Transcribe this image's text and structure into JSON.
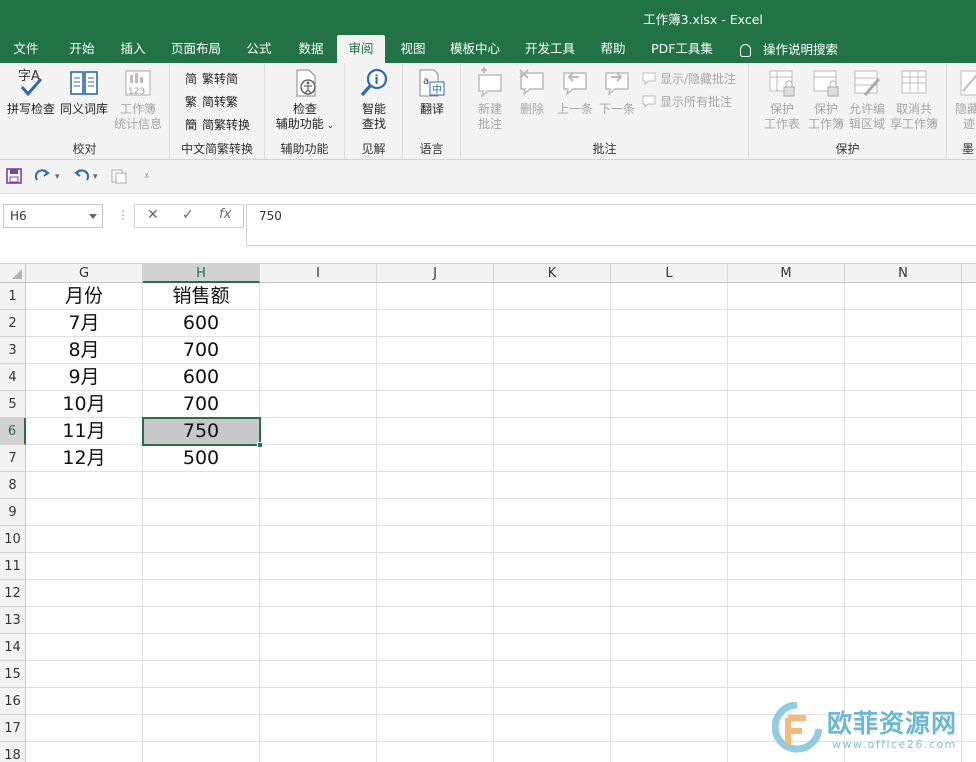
{
  "window": {
    "title": "工作簿3.xlsx  -  Excel"
  },
  "tabs": [
    {
      "label": "文件",
      "active": false
    },
    {
      "label": "开始",
      "active": false
    },
    {
      "label": "插入",
      "active": false
    },
    {
      "label": "页面布局",
      "active": false
    },
    {
      "label": "公式",
      "active": false
    },
    {
      "label": "数据",
      "active": false
    },
    {
      "label": "审阅",
      "active": true
    },
    {
      "label": "视图",
      "active": false
    },
    {
      "label": "模板中心",
      "active": false
    },
    {
      "label": "开发工具",
      "active": false
    },
    {
      "label": "帮助",
      "active": false
    },
    {
      "label": "PDF工具集",
      "active": false
    }
  ],
  "search": {
    "label": "操作说明搜索",
    "icon": "lightbulb-icon"
  },
  "ribbon": {
    "proofing": {
      "label": "校对",
      "spell": "拼写检查",
      "thesaurus": "同义词库",
      "stats_line1": "工作簿",
      "stats_line2": "统计信息"
    },
    "chinese": {
      "label": "中文简繁转换",
      "to_simplified": "繁转简",
      "to_traditional": "简转繁",
      "convert": "简繁转换",
      "icon_simplified": "简",
      "icon_traditional": "繁",
      "icon_convert": "簡"
    },
    "accessibility": {
      "label": "辅助功能",
      "line1": "检查",
      "line2": "辅助功能"
    },
    "insights": {
      "label": "见解",
      "line1": "智能",
      "line2": "查找"
    },
    "language": {
      "label": "语言",
      "translate": "翻译"
    },
    "comments": {
      "label": "批注",
      "new_line1": "新建",
      "new_line2": "批注",
      "delete": "删除",
      "prev": "上一条",
      "next": "下一条",
      "show_hide": "显示/隐藏批注",
      "show_all": "显示所有批注"
    },
    "protect": {
      "label": "保护",
      "sheet_line1": "保护",
      "sheet_line2": "工作表",
      "book_line1": "保护",
      "book_line2": "工作簿",
      "allow_line1": "允许编",
      "allow_line2": "辑区域",
      "unshare_line1": "取消共",
      "unshare_line2": "享工作簿"
    },
    "ink": {
      "label": "墨",
      "line1": "隐藏",
      "line2": "迹"
    }
  },
  "formula_bar": {
    "name_box": "H6",
    "value": "750",
    "fx": "fx"
  },
  "columns": [
    "G",
    "H",
    "I",
    "J",
    "K",
    "L",
    "M",
    "N"
  ],
  "selected_column": "H",
  "rows": [
    "1",
    "2",
    "3",
    "4",
    "5",
    "6",
    "7",
    "8",
    "9",
    "10",
    "11",
    "12",
    "13",
    "14",
    "15",
    "16",
    "17",
    "18"
  ],
  "selected_row": "6",
  "sheet": {
    "header": [
      "月份",
      "销售额"
    ],
    "data": [
      [
        "7月",
        "600"
      ],
      [
        "8月",
        "700"
      ],
      [
        "9月",
        "600"
      ],
      [
        "10月",
        "700"
      ],
      [
        "11月",
        "750"
      ],
      [
        "12月",
        "500"
      ]
    ]
  },
  "watermark": {
    "text": "欧菲资源网",
    "url": "www.office26.com"
  },
  "colors": {
    "excel_green": "#217346",
    "ribbon_bg": "#f3f3f3"
  }
}
